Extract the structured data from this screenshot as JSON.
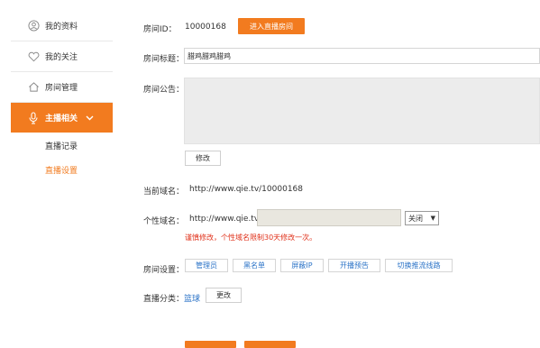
{
  "sidebar": {
    "items": [
      {
        "label": "我的资料",
        "icon": "user-icon"
      },
      {
        "label": "我的关注",
        "icon": "heart-icon"
      },
      {
        "label": "房间管理",
        "icon": "home-icon"
      },
      {
        "label": "主播相关",
        "icon": "microphone-icon"
      }
    ],
    "sub_items": [
      {
        "label": "直播记录"
      },
      {
        "label": "直播设置"
      }
    ]
  },
  "room": {
    "id_label": "房间ID：",
    "id_value": "10000168",
    "enter_button": "进入直播房间",
    "title_label": "房间标题：",
    "title_value": "腊鸡腊鸡腊鸡",
    "notice_label": "房间公告：",
    "modify_button": "修改",
    "domain_label": "当前域名：",
    "domain_value": "http://www.qie.tv/10000168",
    "custom_label": "个性域名：",
    "custom_prefix": "http://www.qie.tv/",
    "custom_select": "关闭",
    "custom_warning": "谨慎修改，个性域名限制30天修改一次。",
    "settings_label": "房间设置：",
    "settings_buttons": [
      "管理员",
      "黑名单",
      "屏蔽IP",
      "开播预告",
      "切换推流线路"
    ],
    "category_label": "直播分类：",
    "category_value": "篮球",
    "change_button": "更改"
  },
  "colors": {
    "accent": "#f27b1f",
    "link": "#2b73c7",
    "warning": "#e0321b"
  }
}
